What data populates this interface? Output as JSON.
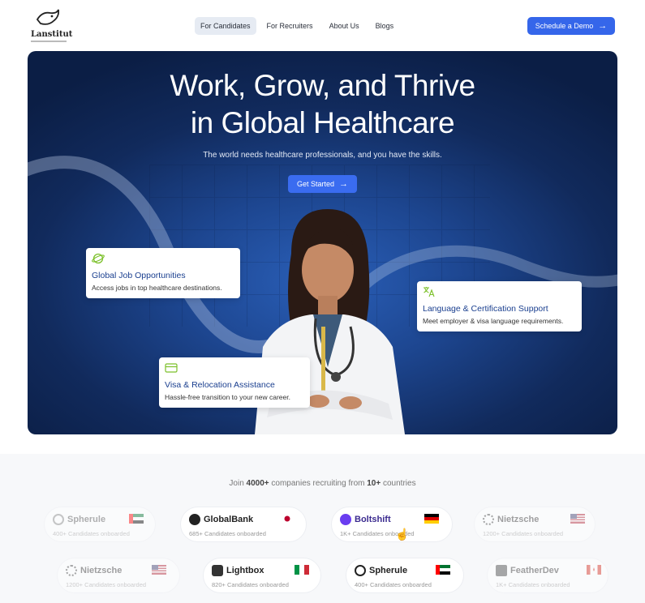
{
  "nav": {
    "logo_text": "Lanstitut",
    "items": [
      {
        "label": "For Candidates",
        "active": true
      },
      {
        "label": "For Recruiters",
        "active": false
      },
      {
        "label": "About Us",
        "active": false
      },
      {
        "label": "Blogs",
        "active": false
      }
    ],
    "cta_label": "Schedule a Demo",
    "cta_icon": "arrow-right-icon"
  },
  "hero": {
    "title_line1": "Work, Grow, and Thrive",
    "title_line2": "in Global Healthcare",
    "subtitle": "The world needs healthcare professionals, and you have the skills.",
    "button_label": "Get Started",
    "button_icon": "arrow-right-icon"
  },
  "cards": [
    {
      "icon": "globe-icon",
      "title": "Global Job Opportunities",
      "desc": "Access jobs in top healthcare destinations."
    },
    {
      "icon": "translate-icon",
      "title": "Language & Certification Support",
      "desc": "Meet employer & visa language requirements."
    },
    {
      "icon": "card-icon",
      "title": "Visa & Relocation Assistance",
      "desc": "Hassle-free transition to your new career."
    }
  ],
  "companies": {
    "intro_prefix": "Join ",
    "intro_count": "4000+",
    "intro_middle": " companies recruiting from ",
    "intro_countries": "10+",
    "intro_suffix": " countries",
    "row1": [
      {
        "name": "Spherule",
        "count": "400+ Candidates onboarded",
        "flag": "UAE"
      },
      {
        "name": "GlobalBank",
        "count": "685+ Candidates onboarded",
        "flag": "Japan"
      },
      {
        "name": "Boltshift",
        "count": "1K+ Candidates onboarded",
        "flag": "Germany"
      },
      {
        "name": "Nietzsche",
        "count": "1200+ Candidates onboarded",
        "flag": "USA"
      }
    ],
    "row2": [
      {
        "name": "Nietzsche",
        "count": "1200+ Candidates onboarded",
        "flag": "USA"
      },
      {
        "name": "Lightbox",
        "count": "820+ Candidates onboarded",
        "flag": "Italy"
      },
      {
        "name": "Spherule",
        "count": "400+ Candidates onboarded",
        "flag": "UAE"
      },
      {
        "name": "FeatherDev",
        "count": "1K+ Candidates onboarded",
        "flag": "Canada"
      }
    ]
  },
  "colors": {
    "primary": "#3566ea",
    "hero_dark": "#0b1e45",
    "card_title": "#1a3f8f",
    "accent_green": "#7cc02a"
  }
}
